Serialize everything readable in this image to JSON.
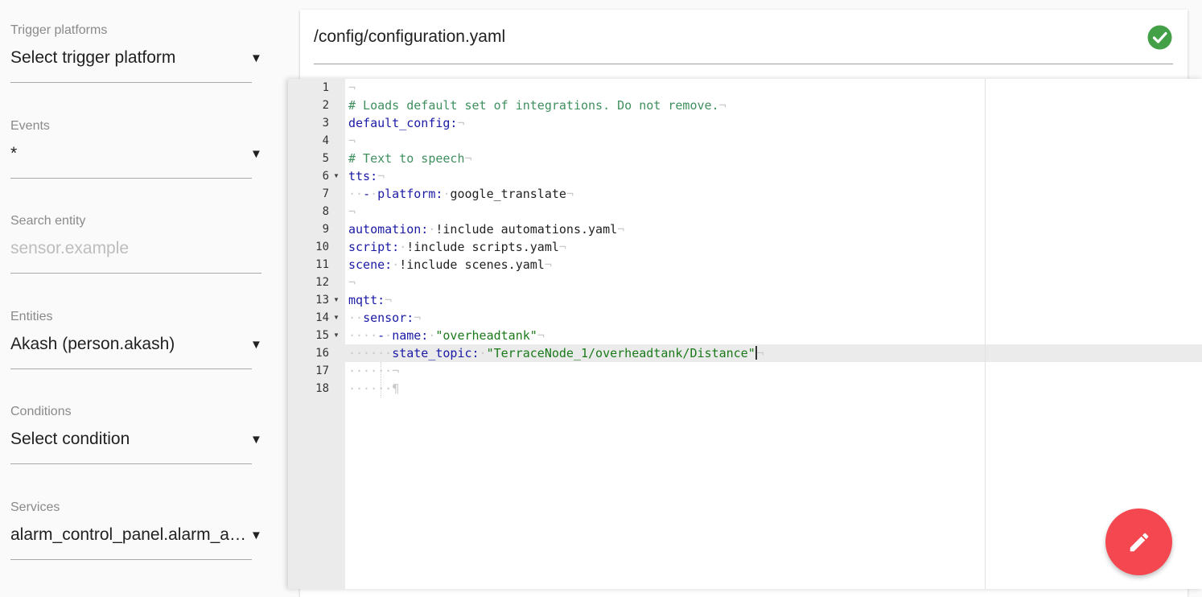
{
  "sidebar": {
    "trigger_platforms": {
      "label": "Trigger platforms",
      "value": "Select trigger platform"
    },
    "events": {
      "label": "Events",
      "value": "*"
    },
    "search_entity": {
      "label": "Search entity",
      "placeholder": "sensor.example"
    },
    "entities": {
      "label": "Entities",
      "value": "Akash (person.akash)"
    },
    "conditions": {
      "label": "Conditions",
      "value": "Select condition"
    },
    "services": {
      "label": "Services",
      "value": "alarm_control_panel.alarm_arm_away"
    },
    "caret": "▼"
  },
  "file": {
    "path": "/config/configuration.yaml",
    "status_icon": "check-circle-icon",
    "status_color": "#43a047"
  },
  "editor": {
    "line_numbers": [
      "1",
      "2",
      "3",
      "4",
      "5",
      "6",
      "7",
      "8",
      "9",
      "10",
      "11",
      "12",
      "13",
      "14",
      "15",
      "16",
      "17",
      "18"
    ],
    "fold_marker": "▼",
    "eol": "¬",
    "eof": "¶",
    "lines": {
      "l2": "# Loads default set of integrations. Do not remove.",
      "l3": "default_config:",
      "l5": "# Text to speech",
      "l6": "tts:",
      "l7_dash": "-",
      "l7_key": "platform:",
      "l7_val": "google_translate",
      "l9_key": "automation:",
      "l9_val": "!include automations.yaml",
      "l10_key": "script:",
      "l10_val": "!include scripts.yaml",
      "l11_key": "scene:",
      "l11_val": "!include scenes.yaml",
      "l13": "mqtt:",
      "l14": "sensor:",
      "l15_dash": "-",
      "l15_key": "name:",
      "l15_val": "\"overheadtank\"",
      "l16_key": "state_topic:",
      "l16_val": "\"TerraceNode_1/overheadtank/Distance\""
    },
    "active_line": 16
  },
  "fab": {
    "icon": "pencil-icon",
    "color": "#f4474f"
  }
}
